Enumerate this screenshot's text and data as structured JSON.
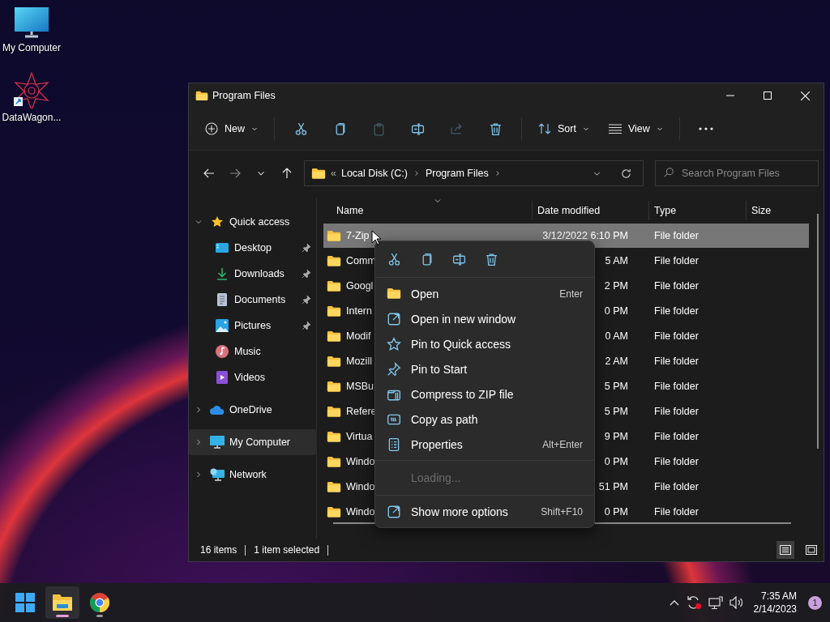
{
  "desktop_icons": [
    {
      "label": "My Computer",
      "kind": "computer"
    },
    {
      "label": "DataWagon...",
      "kind": "shortcut"
    }
  ],
  "window": {
    "title": "Program Files"
  },
  "toolbar": {
    "new_label": "New",
    "sort_label": "Sort",
    "view_label": "View",
    "actions": [
      {
        "kind": "cut",
        "disabled": false
      },
      {
        "kind": "copy",
        "disabled": false
      },
      {
        "kind": "paste",
        "disabled": true
      },
      {
        "kind": "rename",
        "disabled": false
      },
      {
        "kind": "share",
        "disabled": true
      },
      {
        "kind": "delete",
        "disabled": false
      }
    ]
  },
  "nav_buttons": [
    {
      "kind": "back",
      "disabled": false
    },
    {
      "kind": "forward",
      "disabled": true
    },
    {
      "kind": "recent",
      "disabled": false
    },
    {
      "kind": "up",
      "disabled": false
    }
  ],
  "address": {
    "overflow": "«",
    "crumbs": [
      "Local Disk (C:)",
      "Program Files"
    ]
  },
  "search": {
    "placeholder": "Search Program Files"
  },
  "sidebar": {
    "items": [
      {
        "label": "Quick access",
        "kind": "star",
        "expanded": true,
        "selected": false,
        "children": [
          {
            "label": "Desktop",
            "kind": "desktop",
            "pinned": true,
            "selected": false
          },
          {
            "label": "Downloads",
            "kind": "downloads",
            "pinned": true,
            "selected": false
          },
          {
            "label": "Documents",
            "kind": "documents",
            "pinned": true,
            "selected": false
          },
          {
            "label": "Pictures",
            "kind": "pictures",
            "pinned": true,
            "selected": false
          },
          {
            "label": "Music",
            "kind": "music",
            "pinned": false,
            "selected": false
          },
          {
            "label": "Videos",
            "kind": "videos",
            "pinned": false,
            "selected": false
          }
        ]
      },
      {
        "label": "OneDrive",
        "kind": "cloud",
        "expanded": false,
        "selected": false
      },
      {
        "label": "My Computer",
        "kind": "computer",
        "expanded": false,
        "selected": true
      },
      {
        "label": "Network",
        "kind": "network",
        "expanded": false,
        "selected": false
      }
    ]
  },
  "table": {
    "columns": [
      "Name",
      "Date modified",
      "Type",
      "Size"
    ],
    "rows": [
      {
        "name": "7-Zip",
        "date": "3/12/2022 6:10 PM",
        "type": "File folder",
        "selected": true
      },
      {
        "name": "Comm",
        "date": "5 AM",
        "type": "File folder",
        "selected": false
      },
      {
        "name": "Googl",
        "date": "2 PM",
        "type": "File folder",
        "selected": false
      },
      {
        "name": "Intern",
        "date": "0 PM",
        "type": "File folder",
        "selected": false
      },
      {
        "name": "Modif",
        "date": "0 AM",
        "type": "File folder",
        "selected": false
      },
      {
        "name": "Mozill",
        "date": "2 AM",
        "type": "File folder",
        "selected": false
      },
      {
        "name": "MSBu",
        "date": "5 PM",
        "type": "File folder",
        "selected": false
      },
      {
        "name": "Refere",
        "date": "5 PM",
        "type": "File folder",
        "selected": false
      },
      {
        "name": "Virtua",
        "date": "9 PM",
        "type": "File folder",
        "selected": false
      },
      {
        "name": "Windo",
        "date": "0 PM",
        "type": "File folder",
        "selected": false
      },
      {
        "name": "Windo",
        "date": "51 PM",
        "type": "File folder",
        "selected": false
      },
      {
        "name": "Windo",
        "date": "0 PM",
        "type": "File folder",
        "selected": false
      }
    ]
  },
  "context_menu": {
    "quick_actions": [
      {
        "kind": "cut"
      },
      {
        "kind": "copy"
      },
      {
        "kind": "rename"
      },
      {
        "kind": "delete"
      }
    ],
    "sections": [
      [
        {
          "kind": "open",
          "label": "Open",
          "shortcut": "Enter",
          "disabled": false
        },
        {
          "kind": "new-window",
          "label": "Open in new window",
          "disabled": false
        },
        {
          "kind": "pin-quick",
          "label": "Pin to Quick access",
          "disabled": false
        },
        {
          "kind": "pin-start",
          "label": "Pin to Start",
          "disabled": false
        },
        {
          "kind": "zip",
          "label": "Compress to ZIP file",
          "disabled": false
        },
        {
          "kind": "path",
          "label": "Copy as path",
          "disabled": false
        },
        {
          "kind": "properties",
          "label": "Properties",
          "shortcut": "Alt+Enter",
          "disabled": false
        }
      ],
      [
        {
          "kind": "none",
          "label": "Loading...",
          "disabled": true
        }
      ],
      [
        {
          "kind": "more",
          "label": "Show more options",
          "shortcut": "Shift+F10",
          "disabled": false
        }
      ]
    ]
  },
  "status_bar": {
    "count": "16 items",
    "selection": "1 item selected",
    "view_modes": [
      {
        "kind": "details",
        "selected": true
      },
      {
        "kind": "tiles",
        "selected": false
      }
    ]
  },
  "taskbar": {
    "apps": [
      {
        "kind": "start",
        "active": false,
        "running": false
      },
      {
        "kind": "explorer",
        "active": true,
        "running": true
      },
      {
        "kind": "chrome",
        "active": false,
        "running": true
      }
    ],
    "time": "7:35 AM",
    "date": "2/14/2023",
    "notification_count": "1"
  }
}
